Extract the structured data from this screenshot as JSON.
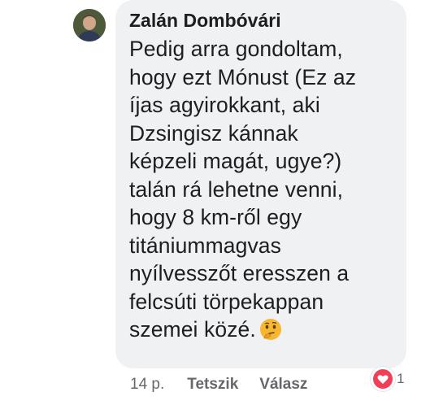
{
  "comment": {
    "author": "Zalán Dombóvári",
    "text": "Pedig arra gondoltam,\nhogy ezt Mónust (Ez az\níjas agyirokkant, aki\nDzsingisz kánnak\nképzeli magát, ugye?)\ntalán rá lehetne venni,\nhogy 8 km-ről egy\ntitániummagvas\nnyílvesszőt eresszen a\nfelcsúti törpekappan\nszemei közé.",
    "emoji": "thinking-face-icon"
  },
  "actions": {
    "time": "14 p.",
    "like_label": "Tetszik",
    "reply_label": "Válasz"
  },
  "reaction": {
    "icon": "heart-icon",
    "count": "1",
    "color": "#f33e58"
  },
  "colors": {
    "bubble_bg": "#f0f1f3",
    "text": "#1c1e21",
    "meta_text": "#65676b"
  }
}
